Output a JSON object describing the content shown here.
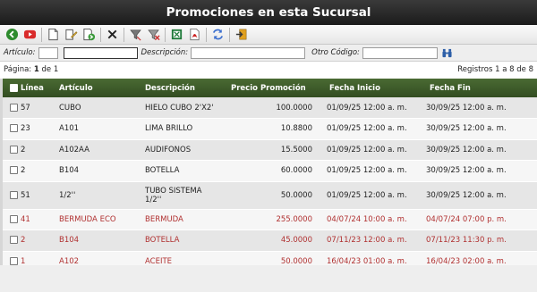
{
  "title": "Promociones en esta Sucursal",
  "toolbar": {
    "buttons": [
      {
        "name": "back-icon",
        "color": "#2e8b2e"
      },
      {
        "name": "youtube-icon",
        "color": "#d92b2b"
      },
      {
        "name": "new-document-icon",
        "color": "#ffffff"
      },
      {
        "name": "edit-document-icon",
        "color": "#f0c040"
      },
      {
        "name": "export-document-icon",
        "color": "#3a9a3a"
      },
      {
        "name": "delete-icon",
        "color": "#222222"
      },
      {
        "name": "filter-icon",
        "color": "#777777"
      },
      {
        "name": "clear-filter-icon",
        "color": "#cc3333"
      },
      {
        "name": "excel-icon",
        "color": "#1f7a3a"
      },
      {
        "name": "pdf-icon",
        "color": "#cc2222"
      },
      {
        "name": "refresh-icon",
        "color": "#3b6fcf"
      },
      {
        "name": "exit-icon",
        "color": "#e0a020"
      }
    ]
  },
  "filters": {
    "articulo_label": "Artículo:",
    "articulo_code": "",
    "articulo_value": "",
    "descripcion_label": "Descripción:",
    "descripcion_value": "",
    "otro_codigo_label": "Otro Código:",
    "otro_codigo_value": ""
  },
  "paging": {
    "pagina_label": "Página:",
    "current": "1",
    "of_label": "de 1",
    "registros": "Registros 1 a 8 de 8"
  },
  "table": {
    "columns": [
      "Línea",
      "Artículo",
      "Descripción",
      "Precio Promoción",
      "Fecha Inicio",
      "Fecha Fin"
    ],
    "rows": [
      {
        "linea": "57",
        "articulo": "CUBO",
        "descripcion": "HIELO CUBO 2'X2'",
        "precio": "100.0000",
        "inicio": "01/09/25 12:00 a. m.",
        "fin": "30/09/25 12:00 a. m.",
        "active": true
      },
      {
        "linea": "23",
        "articulo": "A101",
        "descripcion": "LIMA BRILLO",
        "precio": "10.8800",
        "inicio": "01/09/25 12:00 a. m.",
        "fin": "30/09/25 12:00 a. m.",
        "active": true
      },
      {
        "linea": "2",
        "articulo": "A102AA",
        "descripcion": "AUDIFONOS",
        "precio": "15.5000",
        "inicio": "01/09/25 12:00 a. m.",
        "fin": "30/09/25 12:00 a. m.",
        "active": true
      },
      {
        "linea": "2",
        "articulo": "B104",
        "descripcion": "BOTELLA",
        "precio": "60.0000",
        "inicio": "01/09/25 12:00 a. m.",
        "fin": "30/09/25 12:00 a. m.",
        "active": true
      },
      {
        "linea": "51",
        "articulo": "1/2''",
        "descripcion": "TUBO SISTEMA 1/2''",
        "precio": "50.0000",
        "inicio": "01/09/25 12:00 a. m.",
        "fin": "30/09/25 12:00 a. m.",
        "active": true
      },
      {
        "linea": "41",
        "articulo": "BERMUDA ECO",
        "descripcion": "BERMUDA",
        "precio": "255.0000",
        "inicio": "04/07/24 10:00 a. m.",
        "fin": "04/07/24 07:00 p. m.",
        "active": false
      },
      {
        "linea": "2",
        "articulo": "B104",
        "descripcion": "BOTELLA",
        "precio": "45.0000",
        "inicio": "07/11/23 12:00 a. m.",
        "fin": "07/11/23 11:30 p. m.",
        "active": false
      },
      {
        "linea": "1",
        "articulo": "A102",
        "descripcion": "ACEITE",
        "precio": "50.0000",
        "inicio": "16/04/23 01:00 a. m.",
        "fin": "16/04/23 02:00 a. m.",
        "active": false
      }
    ]
  },
  "colors": {
    "header_green": "#3d5c2a",
    "inactive_row_text": "#b03030",
    "title_bar": "#222222"
  }
}
